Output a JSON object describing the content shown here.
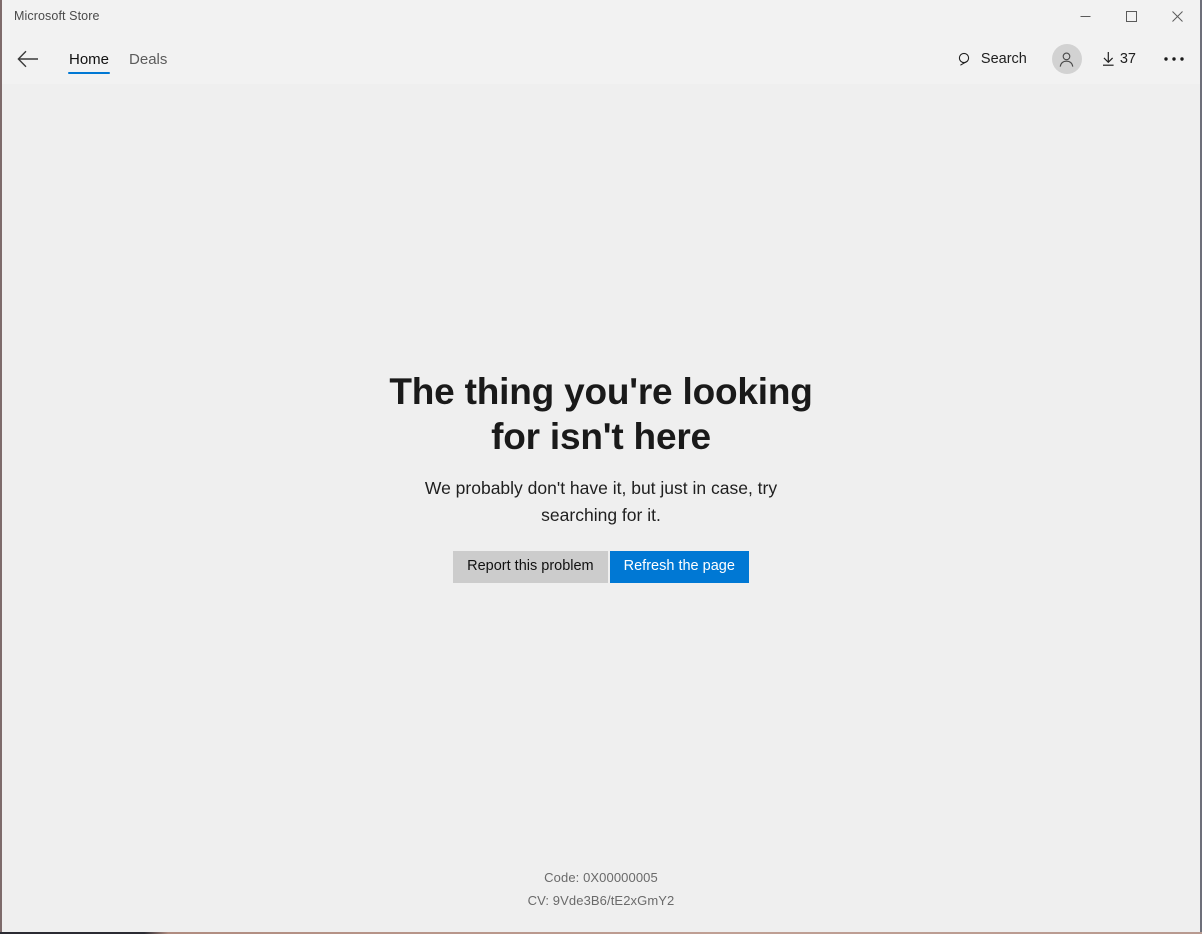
{
  "window": {
    "title": "Microsoft Store",
    "controls": {
      "minimize_label": "Minimize",
      "maximize_label": "Maximize",
      "close_label": "Close"
    }
  },
  "nav": {
    "back_label": "Back",
    "tabs": [
      {
        "label": "Home",
        "active": true
      },
      {
        "label": "Deals",
        "active": false
      }
    ],
    "search_label": "Search",
    "account_label": "Account",
    "downloads_count": "37",
    "more_label": "• • •"
  },
  "error": {
    "title": "The thing you're looking for isn't here",
    "subtitle": "We probably don't have it, but just in case, try searching for it.",
    "report_button_label": "Report this problem",
    "refresh_button_label": "Refresh the page",
    "code_line": "Code: 0X00000005",
    "cv_line": "CV: 9Vde3B6/tE2xGmY2"
  },
  "colors": {
    "accent": "#0078d4",
    "title_bar_bg": "#f2f2f2",
    "content_bg": "#efefef",
    "secondary_button_bg": "#cccccc"
  },
  "icons": {
    "back": "back-arrow-icon",
    "search": "search-icon",
    "account": "account-avatar-icon",
    "downloads": "download-arrow-icon",
    "more": "ellipsis-icon"
  }
}
